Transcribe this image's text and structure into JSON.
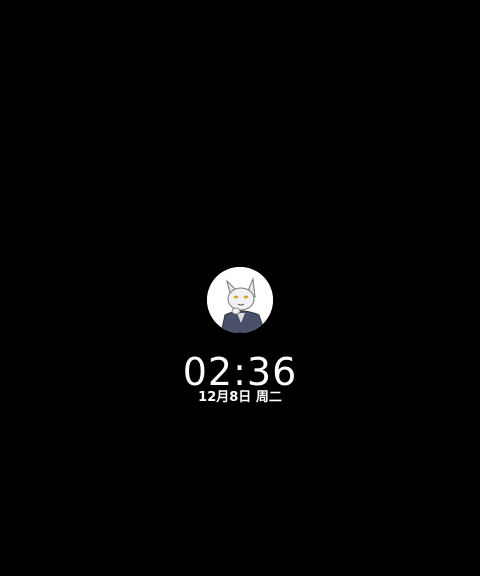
{
  "lockscreen": {
    "avatar_icon": "cat-avatar-icon",
    "time": "02:36",
    "date": "12月8日 周二"
  },
  "colors": {
    "background": "#000000",
    "text": "#ffffff"
  }
}
